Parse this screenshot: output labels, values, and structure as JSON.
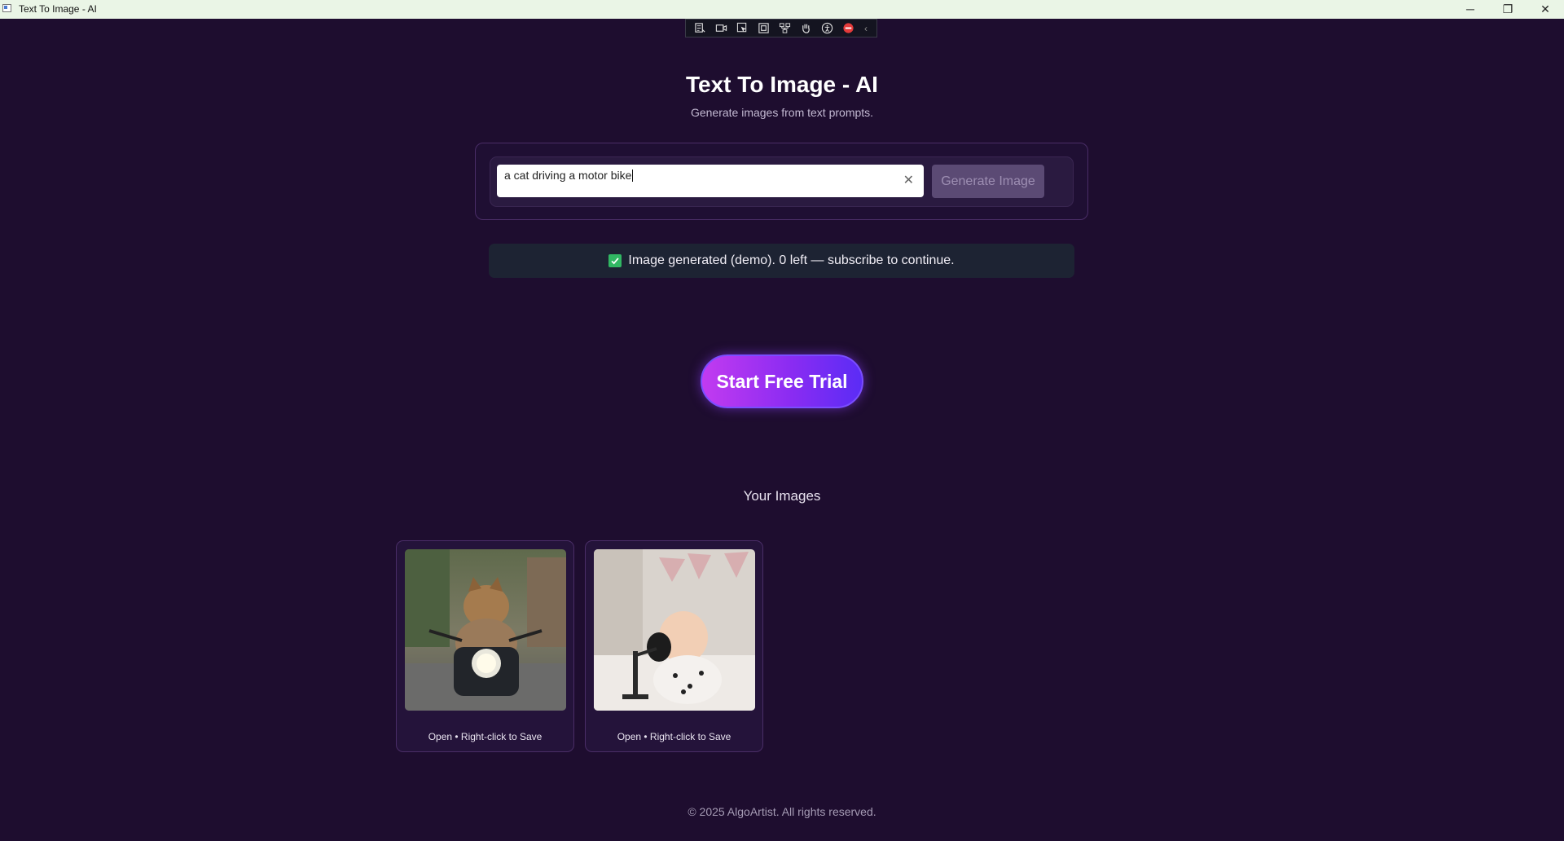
{
  "window": {
    "title": "Text To Image - AI",
    "controls": {
      "minimize": "─",
      "maximize": "❐",
      "close": "✕"
    }
  },
  "toolbar": {
    "icons": [
      "select-text-icon",
      "video-icon",
      "pointer-icon",
      "frame-icon",
      "tree-icon",
      "hand-icon",
      "accessibility-icon",
      "stop-icon"
    ],
    "collapse_glyph": "‹"
  },
  "header": {
    "title": "Text To Image - AI",
    "subtitle": "Generate images from text prompts."
  },
  "prompt": {
    "value": "a cat driving a motor bike",
    "clear_glyph": "✕",
    "generate_label": "Generate Image"
  },
  "status": {
    "message": "Image generated (demo). 0 left — subscribe to continue."
  },
  "cta": {
    "label": "Start Free Trial"
  },
  "gallery": {
    "title": "Your Images",
    "items": [
      {
        "subject": "cat riding motorcycle",
        "caption": "Open • Right-click to Save"
      },
      {
        "subject": "baby with microphone",
        "caption": "Open • Right-click to Save"
      }
    ]
  },
  "footer": {
    "text": "© 2025 AlgoArtist. All rights reserved."
  },
  "colors": {
    "background": "#1e0d2f",
    "accent_start": "#c23bf0",
    "accent_end": "#5b2cf5",
    "success": "#31b763"
  }
}
